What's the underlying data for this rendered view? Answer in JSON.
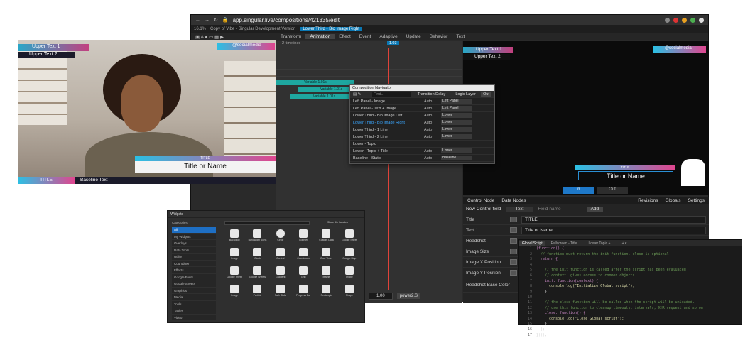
{
  "browser": {
    "url": "app.singular.live/compositions/421335/edit",
    "zoom": "16.1%"
  },
  "app": {
    "breadcrumb": "Copy of Vibe - Singular Development Version",
    "active_comp": "Lower Third - Bio Image Right"
  },
  "tabs": [
    "Transform",
    "Animation",
    "Effect",
    "Event",
    "Adaptive",
    "Update",
    "Behavior",
    "Text"
  ],
  "timeline": {
    "label": "2 timelines",
    "time": "1.03",
    "segments": [
      "Variable 1.01s",
      "Variable 1.01s",
      "Variable 1.01s"
    ]
  },
  "navigator": {
    "title": "Composition Navigator",
    "search_placeholder": "Find...",
    "col_transition": "Transition Delay",
    "col_logic": "Logic Layer",
    "out": "Out",
    "rows": [
      {
        "name": "Left Panel - Image",
        "auto": "Auto",
        "layer": "Left Panel"
      },
      {
        "name": "Left Panel - Text + Image",
        "auto": "Auto",
        "layer": "Left Panel"
      },
      {
        "name": "Lower Third - Bio Image Left",
        "auto": "Auto",
        "layer": "Lower"
      },
      {
        "name": "Lower Third - Bio Image Right",
        "auto": "Auto",
        "layer": "Lower"
      },
      {
        "name": "Lower Third - 1 Line",
        "auto": "Auto",
        "layer": "Lower"
      },
      {
        "name": "Lower Third - 2 Line",
        "auto": "Auto",
        "layer": "Lower"
      },
      {
        "name": "Lower - Topic",
        "auto": "",
        "layer": ""
      },
      {
        "name": "Lower - Topic + Title",
        "auto": "Auto",
        "layer": "Lower"
      },
      {
        "name": "Baseline - Static",
        "auto": "Auto",
        "layer": "Baseline"
      }
    ]
  },
  "preview": {
    "upper1": "Upper Text 1",
    "upper2": "Upper Text 2",
    "social": "@socialmedia",
    "title": "TITLE",
    "name": "Title or Name",
    "in": "In",
    "out": "Out"
  },
  "photo": {
    "upper1": "Upper Text 1",
    "upper2": "Upper Text 2",
    "social": "@socialmedia",
    "title": "TITLE",
    "name": "Title or Name",
    "base_title": "TITLE",
    "base_text": "Baseline Text"
  },
  "control": {
    "tabs": [
      "Control Node",
      "Data Nodes"
    ],
    "right_tabs": [
      "Revisions",
      "Globals",
      "Settings"
    ],
    "new_field": "New Control field",
    "type": "Text",
    "field_name": "Field name",
    "add": "Add",
    "fields": [
      {
        "label": "Title",
        "value": "TITLE"
      },
      {
        "label": "Text 1",
        "value": "Title or Name"
      },
      {
        "label": "Headshot",
        "value": ""
      },
      {
        "label": "Image Size",
        "value": ""
      },
      {
        "label": "Image X Position",
        "value": ""
      },
      {
        "label": "Image Y Position",
        "value": ""
      },
      {
        "label": "Headshot Base Color",
        "value": ""
      }
    ],
    "scale": "1.00",
    "power": "power2.S"
  },
  "widgets": {
    "title": "Widgets",
    "categories_label": "Categories",
    "search_placeholder": "",
    "show_all": "Show Bin Includes",
    "categories": [
      "All",
      "My Widgets",
      "Overlays",
      "Data Tools",
      "Utility",
      "Countdown",
      "Effects",
      "Google Fonts",
      "Google Sheets",
      "Graphics",
      "Media",
      "Tools",
      "Tables",
      "Video"
    ],
    "items": [
      "Backdrop",
      "Bandwidth Icons",
      "Circle",
      "Counter",
      "Custom Data",
      "Google Sheet",
      "Image",
      "Clock",
      "Control",
      "Countdown",
      "Goal Timer",
      "Google Map",
      "Google Sheet",
      "Google Sheets",
      "Gradient",
      "Grid",
      "Iframe",
      "Image",
      "Image",
      "Particle",
      "Path Slide",
      "Progress Bar",
      "Rectangle",
      "Shape"
    ]
  },
  "code": {
    "tabs": [
      "Global Script",
      "Fullscreen - Title...",
      "Lower Topic +..."
    ],
    "lines": [
      "(function() {",
      "  // function must return the init function. close is optional",
      "  return {",
      "",
      "    // the init function is called after the script has been evaluated",
      "    // context: gives access to common objects",
      "    init: function(context) {",
      "      console.log(\"Initialize Global script\");",
      "    },",
      "",
      "    // the close function will be called when the script will be unloaded.",
      "    // use this function to cleanup timeouts, intervals, XHR request and so on",
      "    close: function() {",
      "      console.log(\"Close Global script\");",
      "    }",
      "  };",
      "})();"
    ]
  }
}
